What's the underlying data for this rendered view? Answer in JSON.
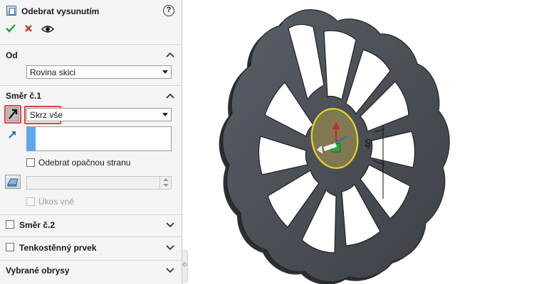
{
  "feature": {
    "title": "Odebrat vysunutím",
    "help_glyph": "?",
    "ok_icon": "check-icon",
    "cancel_icon": "close-icon",
    "preview_icon": "eye-icon"
  },
  "sections": {
    "from": {
      "title": "Od",
      "start_condition": "Rovina skici"
    },
    "direction1": {
      "title": "Směr č.1",
      "end_condition": "Skrz vše",
      "flip_side_label": "Odebrat opačnou stranu",
      "flip_side_checked": false,
      "draft_angle_value": "",
      "draft_outward_label": "Úkos vně",
      "draft_outward_checked": false
    },
    "direction2": {
      "title": "Směr č.2",
      "checked": false
    },
    "thin_feature": {
      "title": "Tenkostěnný prvek",
      "checked": false
    },
    "selected_contours": {
      "title": "Vybrané obrysy"
    }
  },
  "viewport": {
    "dimension_label": "40",
    "part_color": "#4b4e55",
    "sketch_color": "#8a8050",
    "highlight_color": "#e8d820"
  },
  "colors": {
    "accent": "#5aa9f0",
    "annotation_red": "#e04040",
    "ok_green": "#2a9a32",
    "cancel_red": "#d22424"
  }
}
